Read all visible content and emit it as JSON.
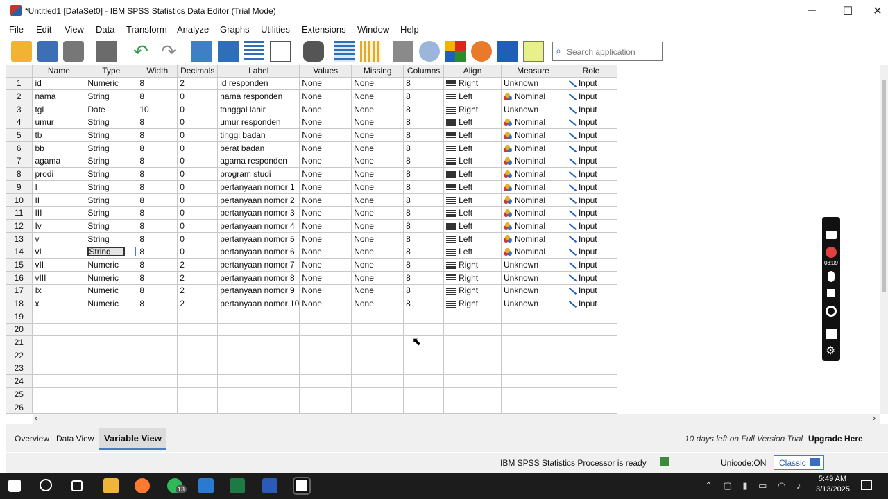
{
  "window": {
    "title": "*Untitled1 [DataSet0] - IBM SPSS Statistics Data Editor (Trial Mode)",
    "minimize": "─",
    "maximize": "☐",
    "close": "✕"
  },
  "menu": [
    "File",
    "Edit",
    "View",
    "Data",
    "Transform",
    "Analyze",
    "Graphs",
    "Utilities",
    "Extensions",
    "Window",
    "Help"
  ],
  "toolbar": {
    "icons": [
      "open-icon",
      "save-icon",
      "print-icon",
      "dialog-recall-icon",
      "undo-icon",
      "redo-icon",
      "goto-case-icon",
      "goto-variable-icon",
      "variables-icon",
      "run-descriptive-icon",
      "find-icon",
      "insert-cases-icon",
      "insert-variable-icon",
      "split-file-icon",
      "weight-cases-icon",
      "select-cases-icon",
      "value-labels-icon",
      "use-variable-sets-icon",
      "show-all-variables-icon",
      "spell-check-icon"
    ],
    "search_placeholder": "Search application"
  },
  "grid": {
    "columns": [
      "Name",
      "Type",
      "Width",
      "Decimals",
      "Label",
      "Values",
      "Missing",
      "Columns",
      "Align",
      "Measure",
      "Role"
    ],
    "rows": [
      {
        "n": "1",
        "name": "id",
        "type": "Numeric",
        "width": "8",
        "decimals": "2",
        "label": "id responden",
        "values": "None",
        "missing": "None",
        "columns": "8",
        "align": "Right",
        "measure": "Unknown",
        "role": "Input"
      },
      {
        "n": "2",
        "name": "nama",
        "type": "String",
        "width": "8",
        "decimals": "0",
        "label": "nama responden",
        "values": "None",
        "missing": "None",
        "columns": "8",
        "align": "Left",
        "measure": "Nominal",
        "role": "Input"
      },
      {
        "n": "3",
        "name": "tgl",
        "type": "Date",
        "width": "10",
        "decimals": "0",
        "label": "tanggal lahir",
        "values": "None",
        "missing": "None",
        "columns": "8",
        "align": "Right",
        "measure": "Unknown",
        "role": "Input"
      },
      {
        "n": "4",
        "name": "umur",
        "type": "String",
        "width": "8",
        "decimals": "0",
        "label": "umur responden",
        "values": "None",
        "missing": "None",
        "columns": "8",
        "align": "Left",
        "measure": "Nominal",
        "role": "Input"
      },
      {
        "n": "5",
        "name": "tb",
        "type": "String",
        "width": "8",
        "decimals": "0",
        "label": "tinggi badan",
        "values": "None",
        "missing": "None",
        "columns": "8",
        "align": "Left",
        "measure": "Nominal",
        "role": "Input"
      },
      {
        "n": "6",
        "name": "bb",
        "type": "String",
        "width": "8",
        "decimals": "0",
        "label": "berat badan",
        "values": "None",
        "missing": "None",
        "columns": "8",
        "align": "Left",
        "measure": "Nominal",
        "role": "Input"
      },
      {
        "n": "7",
        "name": "agama",
        "type": "String",
        "width": "8",
        "decimals": "0",
        "label": "agama responden",
        "values": "None",
        "missing": "None",
        "columns": "8",
        "align": "Left",
        "measure": "Nominal",
        "role": "Input"
      },
      {
        "n": "8",
        "name": "prodi",
        "type": "String",
        "width": "8",
        "decimals": "0",
        "label": "program studi",
        "values": "None",
        "missing": "None",
        "columns": "8",
        "align": "Left",
        "measure": "Nominal",
        "role": "Input"
      },
      {
        "n": "9",
        "name": "I",
        "type": "String",
        "width": "8",
        "decimals": "0",
        "label": "pertanyaan nomor 1",
        "values": "None",
        "missing": "None",
        "columns": "8",
        "align": "Left",
        "measure": "Nominal",
        "role": "Input"
      },
      {
        "n": "10",
        "name": "II",
        "type": "String",
        "width": "8",
        "decimals": "0",
        "label": "pertanyaan nomor 2",
        "values": "None",
        "missing": "None",
        "columns": "8",
        "align": "Left",
        "measure": "Nominal",
        "role": "Input"
      },
      {
        "n": "11",
        "name": "III",
        "type": "String",
        "width": "8",
        "decimals": "0",
        "label": "pertanyaan nomor 3",
        "values": "None",
        "missing": "None",
        "columns": "8",
        "align": "Left",
        "measure": "Nominal",
        "role": "Input"
      },
      {
        "n": "12",
        "name": "Iv",
        "type": "String",
        "width": "8",
        "decimals": "0",
        "label": "pertanyaan nomor 4",
        "values": "None",
        "missing": "None",
        "columns": "8",
        "align": "Left",
        "measure": "Nominal",
        "role": "Input"
      },
      {
        "n": "13",
        "name": "v",
        "type": "String",
        "width": "8",
        "decimals": "0",
        "label": "pertanyaan nomor 5",
        "values": "None",
        "missing": "None",
        "columns": "8",
        "align": "Left",
        "measure": "Nominal",
        "role": "Input"
      },
      {
        "n": "14",
        "name": "vI",
        "type": "String",
        "width": "8",
        "decimals": "0",
        "label": "pertanyaan nomor 6",
        "values": "None",
        "missing": "None",
        "columns": "8",
        "align": "Left",
        "measure": "Nominal",
        "role": "Input",
        "selected": true
      },
      {
        "n": "15",
        "name": "vII",
        "type": "Numeric",
        "width": "8",
        "decimals": "2",
        "label": "pertanyaan nomor 7",
        "values": "None",
        "missing": "None",
        "columns": "8",
        "align": "Right",
        "measure": "Unknown",
        "role": "Input"
      },
      {
        "n": "16",
        "name": "vIII",
        "type": "Numeric",
        "width": "8",
        "decimals": "2",
        "label": "pertanyaan nomor 8",
        "values": "None",
        "missing": "None",
        "columns": "8",
        "align": "Right",
        "measure": "Unknown",
        "role": "Input"
      },
      {
        "n": "17",
        "name": "Ix",
        "type": "Numeric",
        "width": "8",
        "decimals": "2",
        "label": "pertanyaan nomor 9",
        "values": "None",
        "missing": "None",
        "columns": "8",
        "align": "Right",
        "measure": "Unknown",
        "role": "Input"
      },
      {
        "n": "18",
        "name": "x",
        "type": "Numeric",
        "width": "8",
        "decimals": "2",
        "label": "pertanyaan nomor 10",
        "values": "None",
        "missing": "None",
        "columns": "8",
        "align": "Right",
        "measure": "Unknown",
        "role": "Input"
      }
    ],
    "empty_rows": [
      "19",
      "20",
      "21",
      "22",
      "23",
      "24",
      "25",
      "26"
    ],
    "selected_cell_button": "..."
  },
  "tabs": [
    "Overview",
    "Data View",
    "Variable View"
  ],
  "active_tab": "Variable View",
  "trial_notice": "10 days left on Full Version Trial",
  "upgrade_link": "Upgrade Here",
  "status": {
    "processor": "IBM SPSS Statistics Processor is ready",
    "unicode": "Unicode:ON",
    "classic": "Classic"
  },
  "recorder": {
    "timer": "03:09"
  },
  "taskbar": {
    "icons": [
      "start-icon",
      "search-icon",
      "task-view-icon",
      "file-explorer-icon",
      "firefox-icon",
      "whatsapp-icon",
      "store-icon",
      "excel-icon",
      "word-icon",
      "terminal-icon"
    ],
    "whatsapp_badge": "13",
    "time": "5:49 AM",
    "date": "3/13/2025"
  }
}
